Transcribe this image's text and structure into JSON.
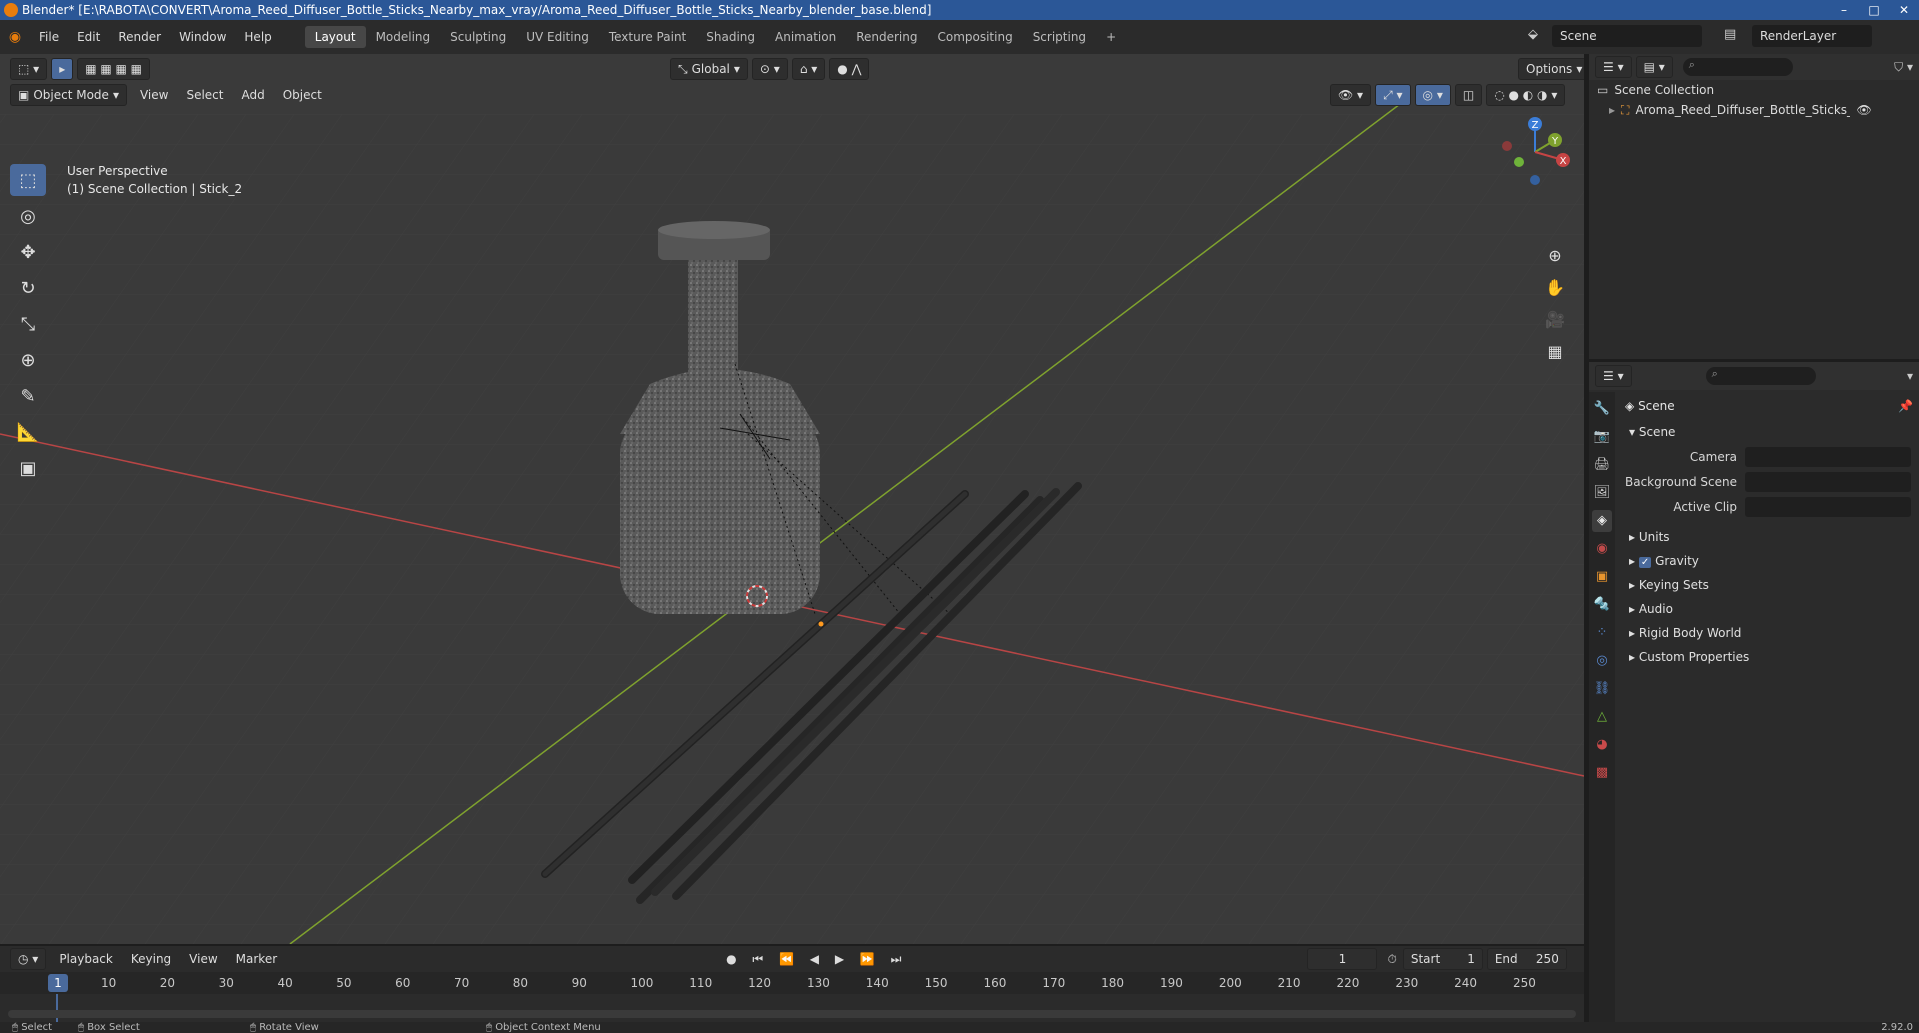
{
  "window": {
    "title": "Blender* [E:\\RABOTA\\CONVERT\\Aroma_Reed_Diffuser_Bottle_Sticks_Nearby_max_vray/Aroma_Reed_Diffuser_Bottle_Sticks_Nearby_blender_base.blend]"
  },
  "menus": [
    "File",
    "Edit",
    "Render",
    "Window",
    "Help"
  ],
  "workspaces": [
    "Layout",
    "Modeling",
    "Sculpting",
    "UV Editing",
    "Texture Paint",
    "Shading",
    "Animation",
    "Rendering",
    "Compositing",
    "Scripting"
  ],
  "workspace_add": "+",
  "scene_name": "Scene",
  "view_layer": "RenderLayer",
  "viewport": {
    "mode": "Object Mode",
    "menus": [
      "View",
      "Select",
      "Add",
      "Object"
    ],
    "orientation": "Global",
    "options": "Options",
    "info_line1": "User Perspective",
    "info_line2": "(1) Scene Collection | Stick_2"
  },
  "gizmo": {
    "z": "Z",
    "y": "Y",
    "x": "X"
  },
  "outliner": {
    "root": "Scene Collection",
    "item": "Aroma_Reed_Diffuser_Bottle_Sticks_Nearby"
  },
  "properties": {
    "title": "Scene",
    "section": "Scene",
    "fields": {
      "camera": "Camera",
      "background_scene": "Background Scene",
      "active_clip": "Active Clip"
    },
    "panels": [
      "Units",
      "Gravity",
      "Keying Sets",
      "Audio",
      "Rigid Body World",
      "Custom Properties"
    ]
  },
  "timeline": {
    "menus": [
      "Playback",
      "Keying",
      "View",
      "Marker"
    ],
    "current_frame": "1",
    "start_label": "Start",
    "start_value": "1",
    "end_label": "End",
    "end_value": "250",
    "ticks": [
      "1",
      "10",
      "20",
      "30",
      "40",
      "50",
      "60",
      "70",
      "80",
      "90",
      "100",
      "110",
      "120",
      "130",
      "140",
      "150",
      "160",
      "170",
      "180",
      "190",
      "200",
      "210",
      "220",
      "230",
      "240",
      "250"
    ]
  },
  "status": {
    "select": "Select",
    "box_select": "Box Select",
    "rotate_view": "Rotate View",
    "context_menu": "Object Context Menu",
    "version": "2.92.0"
  },
  "colors": {
    "accent": "#4a6a9c",
    "x_axis": "#c64444",
    "y_axis": "#7fa22e"
  }
}
